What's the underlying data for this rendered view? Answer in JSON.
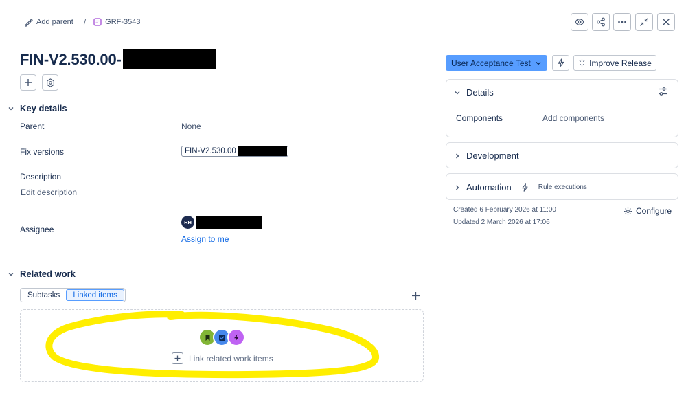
{
  "breadcrumb": {
    "add_parent": "Add parent",
    "separator": "/",
    "issue_key": "GRF-3543"
  },
  "header_icons": [
    "eye-icon",
    "share-icon",
    "more-icon",
    "minimize-icon",
    "close-icon"
  ],
  "issue": {
    "title": "FIN-V2.530.00-"
  },
  "key_details": {
    "heading": "Key details",
    "parent_label": "Parent",
    "parent_value": "None",
    "fix_versions_label": "Fix versions",
    "fix_versions_value": "FIN-V2.530.00",
    "description_label": "Description",
    "description_placeholder": "Edit description",
    "assignee_label": "Assignee",
    "assignee_initials": "RH",
    "assign_to_me": "Assign to me"
  },
  "related_work": {
    "heading": "Related work",
    "tabs": [
      {
        "label": "Subtasks",
        "active": false
      },
      {
        "label": "Linked items",
        "active": true
      }
    ],
    "link_action": "Link related work items"
  },
  "sidebar": {
    "status": "User Acceptance Test",
    "improve_release": "Improve Release",
    "details_heading": "Details",
    "components_label": "Components",
    "components_value": "Add components",
    "development_heading": "Development",
    "automation_heading": "Automation",
    "rule_executions": "Rule executions",
    "created": "Created 6 February 2026 at 11:00",
    "updated": "Updated 2 March 2026 at 17:06",
    "configure": "Configure"
  },
  "colors": {
    "accent": "#579dff",
    "link": "#0c66e4",
    "annotation": "#ffee00",
    "story_icon": "#82b536",
    "task_icon": "#4688ec",
    "epic_icon": "#bf63f3"
  }
}
